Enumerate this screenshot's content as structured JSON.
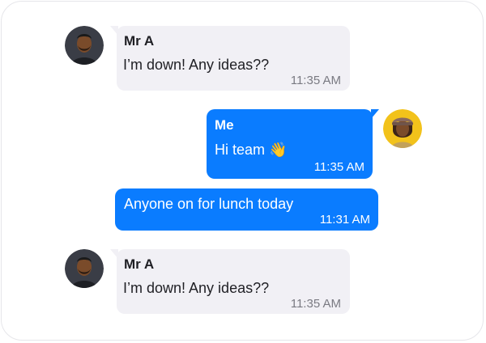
{
  "messages": [
    {
      "sender": "Mr A",
      "text": "I’m down! Any ideas??",
      "time": "11:35 AM"
    },
    {
      "sender": "Me",
      "text": "Hi team",
      "emoji": "👋",
      "time": "11:35 AM"
    },
    {
      "text": "Anyone on for lunch today",
      "time": "11:31 AM"
    },
    {
      "sender": "Mr A",
      "text": "I’m down! Any ideas??",
      "time": "11:35 AM"
    }
  ],
  "colors": {
    "outgoing_bubble": "#0a7cff",
    "incoming_bubble": "#f1f0f5",
    "my_avatar_bg": "#f2c21b",
    "other_avatar_bg": "#3a3d46"
  }
}
